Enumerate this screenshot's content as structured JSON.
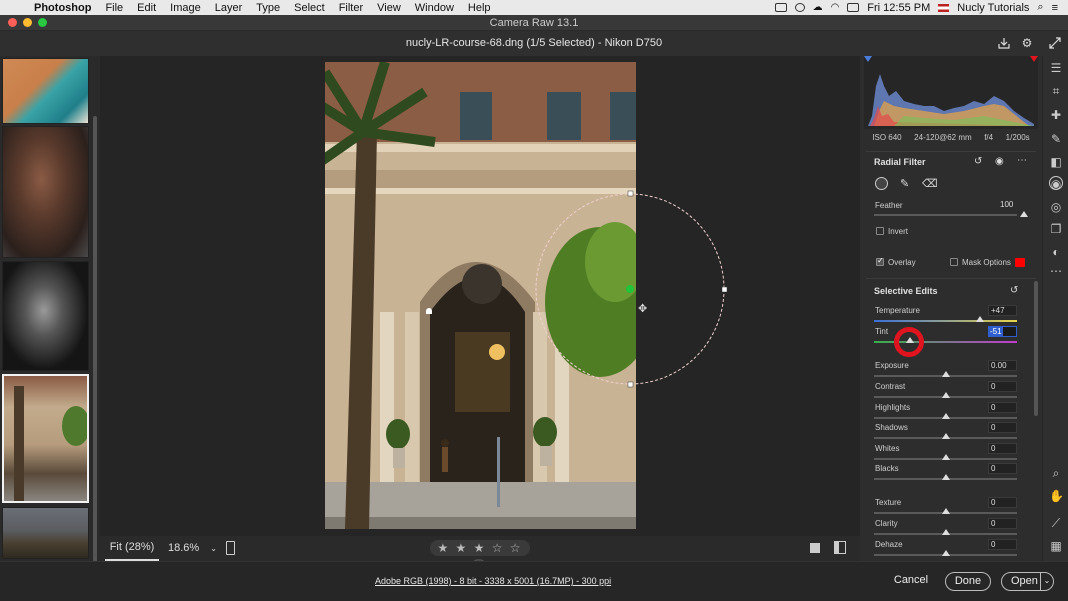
{
  "menubar": {
    "app_name": "Photoshop",
    "items": [
      "File",
      "Edit",
      "Image",
      "Layer",
      "Type",
      "Select",
      "Filter",
      "View",
      "Window",
      "Help"
    ],
    "clock": "Fri 12:55 PM",
    "user": "Nucly Tutorials"
  },
  "window": {
    "title": "Camera Raw 13.1"
  },
  "header": {
    "file_info": "nucly-LR-course-68.dng  (1/5 Selected)  -  Nikon D750"
  },
  "camera_meta": {
    "iso": "ISO 640",
    "lens": "24-120@62 mm",
    "aperture": "f/4",
    "shutter": "1/200s"
  },
  "radial_filter": {
    "title": "Radial Filter",
    "feather_label": "Feather",
    "feather_value": "100",
    "invert_label": "Invert",
    "overlay_label": "Overlay",
    "mask_options_label": "Mask Options",
    "mask_color": "#ff0000"
  },
  "selective_edits": {
    "title": "Selective Edits",
    "sliders": [
      {
        "label": "Temperature",
        "value": "+47",
        "level": 0.74
      },
      {
        "label": "Tint",
        "value": "-51",
        "level": 0.25
      },
      {
        "label": "Exposure",
        "value": "0.00",
        "level": 0.5
      },
      {
        "label": "Contrast",
        "value": "0",
        "level": 0.5
      },
      {
        "label": "Highlights",
        "value": "0",
        "level": 0.5
      },
      {
        "label": "Shadows",
        "value": "0",
        "level": 0.5
      },
      {
        "label": "Whites",
        "value": "0",
        "level": 0.5
      },
      {
        "label": "Blacks",
        "value": "0",
        "level": 0.5
      },
      {
        "label": "Texture",
        "value": "0",
        "level": 0.5
      },
      {
        "label": "Clarity",
        "value": "0",
        "level": 0.5
      },
      {
        "label": "Dehaze",
        "value": "0",
        "level": 0.5
      }
    ]
  },
  "canvas_toolbar": {
    "fit_label": "Fit (28%)",
    "zoom_label": "18.6%",
    "rating_stars": "★ ★ ★ ☆ ☆"
  },
  "statusbar": {
    "workflow_link": "Adobe RGB (1998) - 8 bit - 3338 x 5001 (16.7MP) - 300 ppi",
    "cancel_label": "Cancel",
    "done_label": "Done",
    "open_label": "Open"
  },
  "colors": {
    "accent_red": "#e0141e",
    "mask_swatch": "#ff0000",
    "selected_field": "#2f5fcf"
  }
}
